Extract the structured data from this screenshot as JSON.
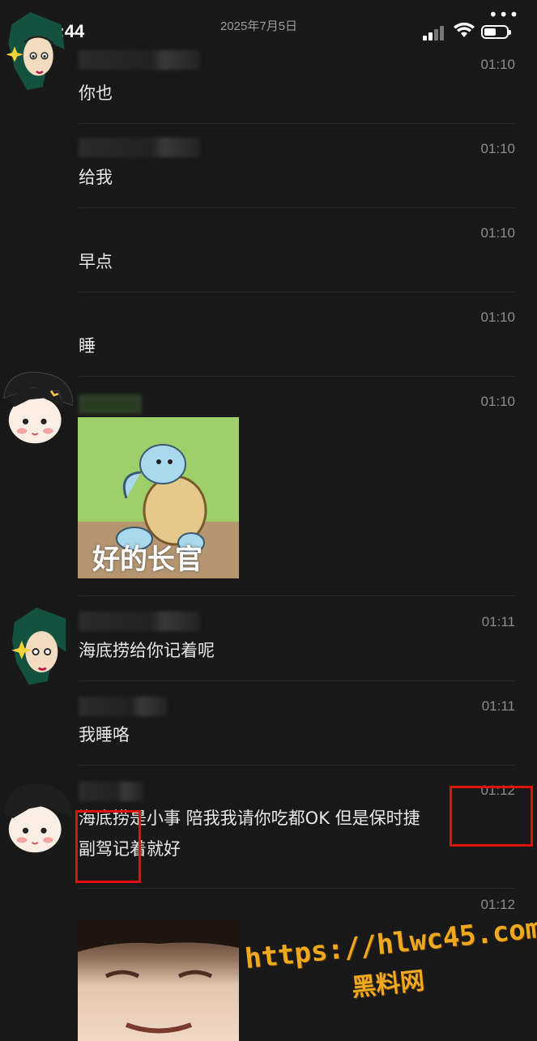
{
  "status_bar": {
    "time": "16:44",
    "date": "2025年7月5日",
    "more": "•••"
  },
  "messages": [
    {
      "sender": "user-a",
      "time": "01:10",
      "text": "你也"
    },
    {
      "sender": "user-a",
      "time": "01:10",
      "text": "给我"
    },
    {
      "sender": "user-a",
      "time": "01:10",
      "text": "早点"
    },
    {
      "sender": "user-a",
      "time": "01:10",
      "text": "睡"
    },
    {
      "sender": "user-b",
      "time": "01:10",
      "sticker_caption": "好的长官"
    },
    {
      "sender": "user-a",
      "time": "01:11",
      "text": "海底捞给你记着呢"
    },
    {
      "sender": "user-a",
      "time": "01:11",
      "text": "我睡咯"
    },
    {
      "sender": "user-b",
      "time": "01:12",
      "text_line1": "海底捞是小事  陪我我请你吃都OK  但是保时捷",
      "text_line2": "副驾记着就好"
    },
    {
      "sender": "user-b",
      "time": "01:12",
      "image": "selfie-photo"
    }
  ],
  "watermark": {
    "url": "https://hlwc45.com",
    "site": "黑料网"
  },
  "colors": {
    "background": "#191919",
    "highlight": "#e01010",
    "watermark": "#f0a81e"
  }
}
